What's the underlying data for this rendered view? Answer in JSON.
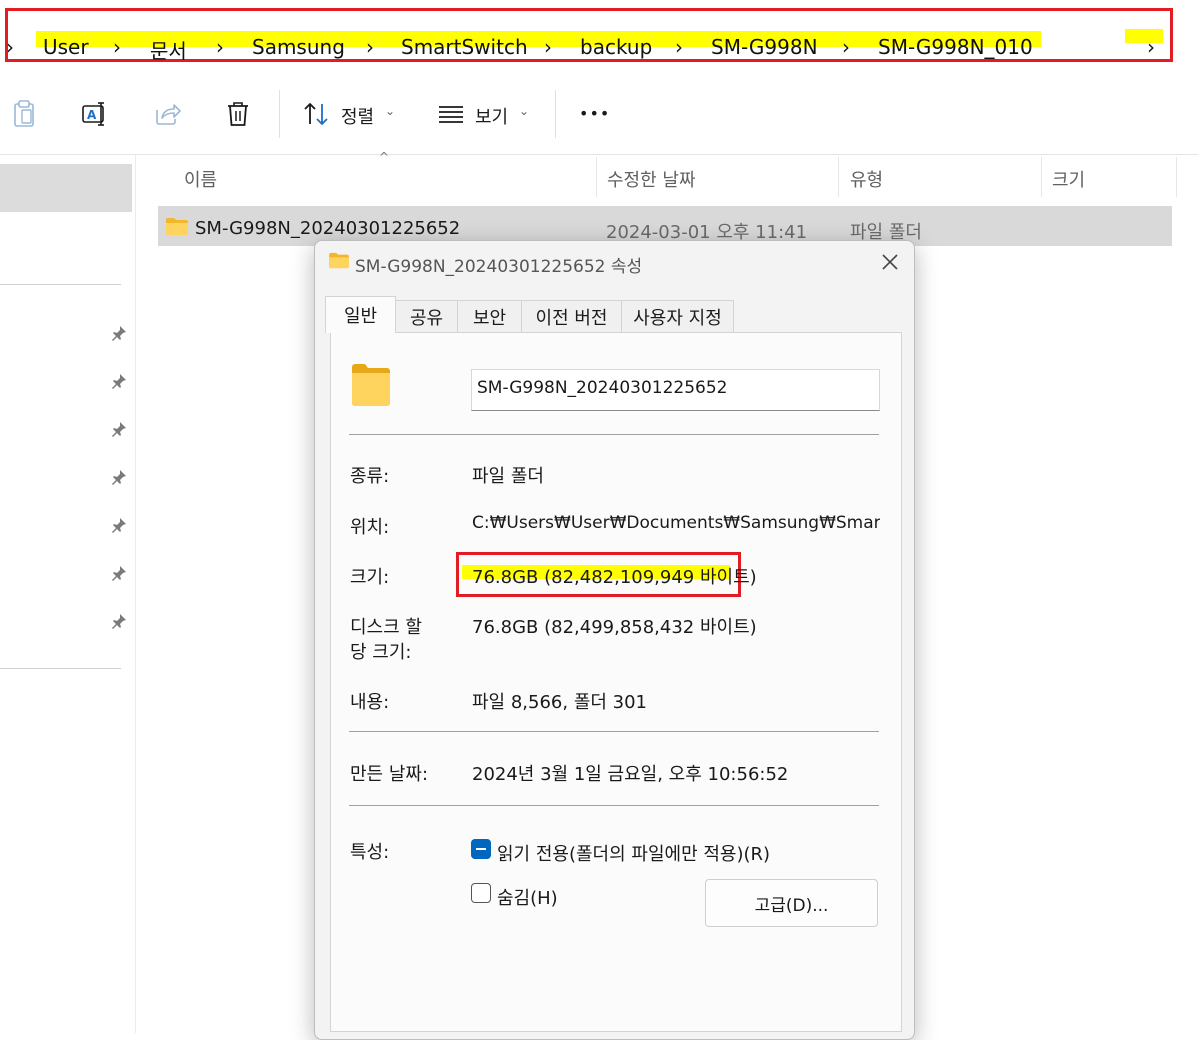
{
  "breadcrumb": {
    "items": [
      "User",
      "문서",
      "Samsung",
      "SmartSwitch",
      "backup",
      "SM-G998N",
      "SM-G998N_010"
    ],
    "separator": "›",
    "highlight_color": "#ffff00",
    "frame_color": "#e31c24"
  },
  "toolbar": {
    "sort_label": "정렬",
    "view_label": "보기",
    "more_label": "•••",
    "icons": [
      "paste-icon",
      "rename-icon",
      "share-icon",
      "delete-icon",
      "sort-icon",
      "view-icon"
    ]
  },
  "columns": {
    "name": "이름",
    "date": "수정한 날짜",
    "type": "유형",
    "size": "크기"
  },
  "file": {
    "name": "SM-G998N_20240301225652",
    "date": "2024-03-01 오후 11:41",
    "type": "파일 폴더"
  },
  "dialog": {
    "title": "SM-G998N_20240301225652 속성",
    "tabs": [
      "일반",
      "공유",
      "보안",
      "이전 버전",
      "사용자 지정"
    ],
    "active_tab": "일반",
    "name_value": "SM-G998N_20240301225652",
    "kind_label": "종류:",
    "kind_value": "파일 폴더",
    "location_label": "위치:",
    "location_value": "C:₩Users₩User₩Documents₩Samsung₩SmartSwi",
    "size_label": "크기:",
    "size_value": "76.8GB (82,482,109,949 바이트)",
    "disk_label_1": "디스크 할",
    "disk_label_2": "당 크기:",
    "disk_value": "76.8GB (82,499,858,432 바이트)",
    "contents_label": "내용:",
    "contents_value": "파일 8,566, 폴더 301",
    "created_label": "만든 날짜:",
    "created_value": "2024년 3월 1일 금요일, 오후 10:56:52",
    "attributes_label": "특성:",
    "readonly_label": "읽기 전용(폴더의 파일에만 적용)(R)",
    "hidden_label": "숨김(H)",
    "advanced_label": "고급(D)...",
    "accent_color": "#0067c0"
  }
}
